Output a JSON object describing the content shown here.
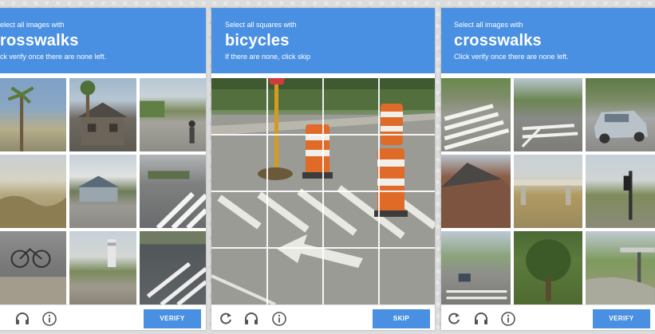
{
  "colors": {
    "accent": "#4a90e2",
    "header_text": "#ffffff"
  },
  "panels": [
    {
      "instruction": "elect all images with",
      "target": "rosswalks",
      "hint": "ck verify once there are none left.",
      "footer_icons": [
        "headphones-icon",
        "info-icon"
      ],
      "button": "VERIFY"
    },
    {
      "instruction": "Select all squares with",
      "target": "bicycles",
      "hint": "If there are none, click skip",
      "footer_icons": [
        "reload-icon",
        "headphones-icon",
        "info-icon"
      ],
      "button": "SKIP"
    },
    {
      "instruction": "Select all images with",
      "target": "crosswalks",
      "hint": "Click verify once there are none left.",
      "footer_icons": [
        "reload-icon",
        "headphones-icon",
        "info-icon"
      ],
      "button": "VERIFY"
    }
  ]
}
